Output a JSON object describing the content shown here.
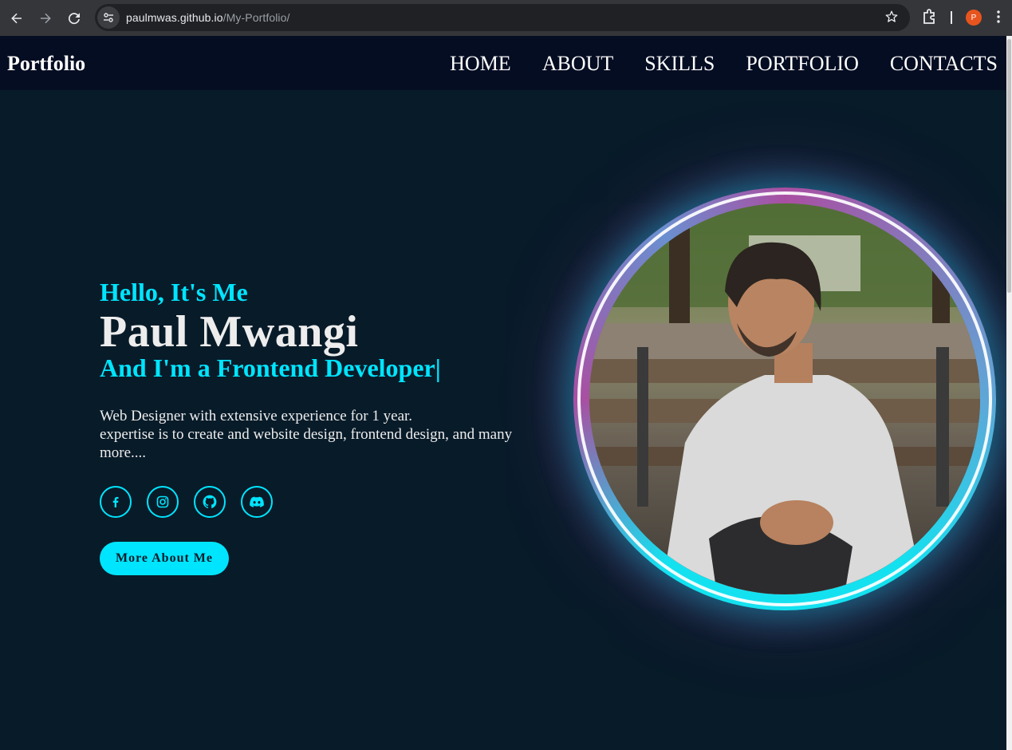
{
  "browser": {
    "url_host": "paulmwas.github.io",
    "url_path": "/My-Portfolio/",
    "profile_initial": "P"
  },
  "header": {
    "logo": "Portfolio",
    "nav": [
      "HOME",
      "ABOUT",
      "SKILLS",
      "PORTFOLIO",
      "CONTACTS"
    ]
  },
  "hero": {
    "greeting": "Hello, It's Me",
    "name": "Paul Mwangi",
    "role": "And I'm a Frontend Developer",
    "cursor": "|",
    "description_line1": "Web Designer with extensive experience for 1 year.",
    "description_line2": "expertise is to create and website design, frontend design, and many more....",
    "socials": [
      "facebook-icon",
      "instagram-icon",
      "github-icon",
      "discord-icon"
    ],
    "button": "More About Me"
  },
  "colors": {
    "accent": "#00e5ff",
    "background": "#081b29",
    "header": "#050d22",
    "text": "#ededed"
  }
}
